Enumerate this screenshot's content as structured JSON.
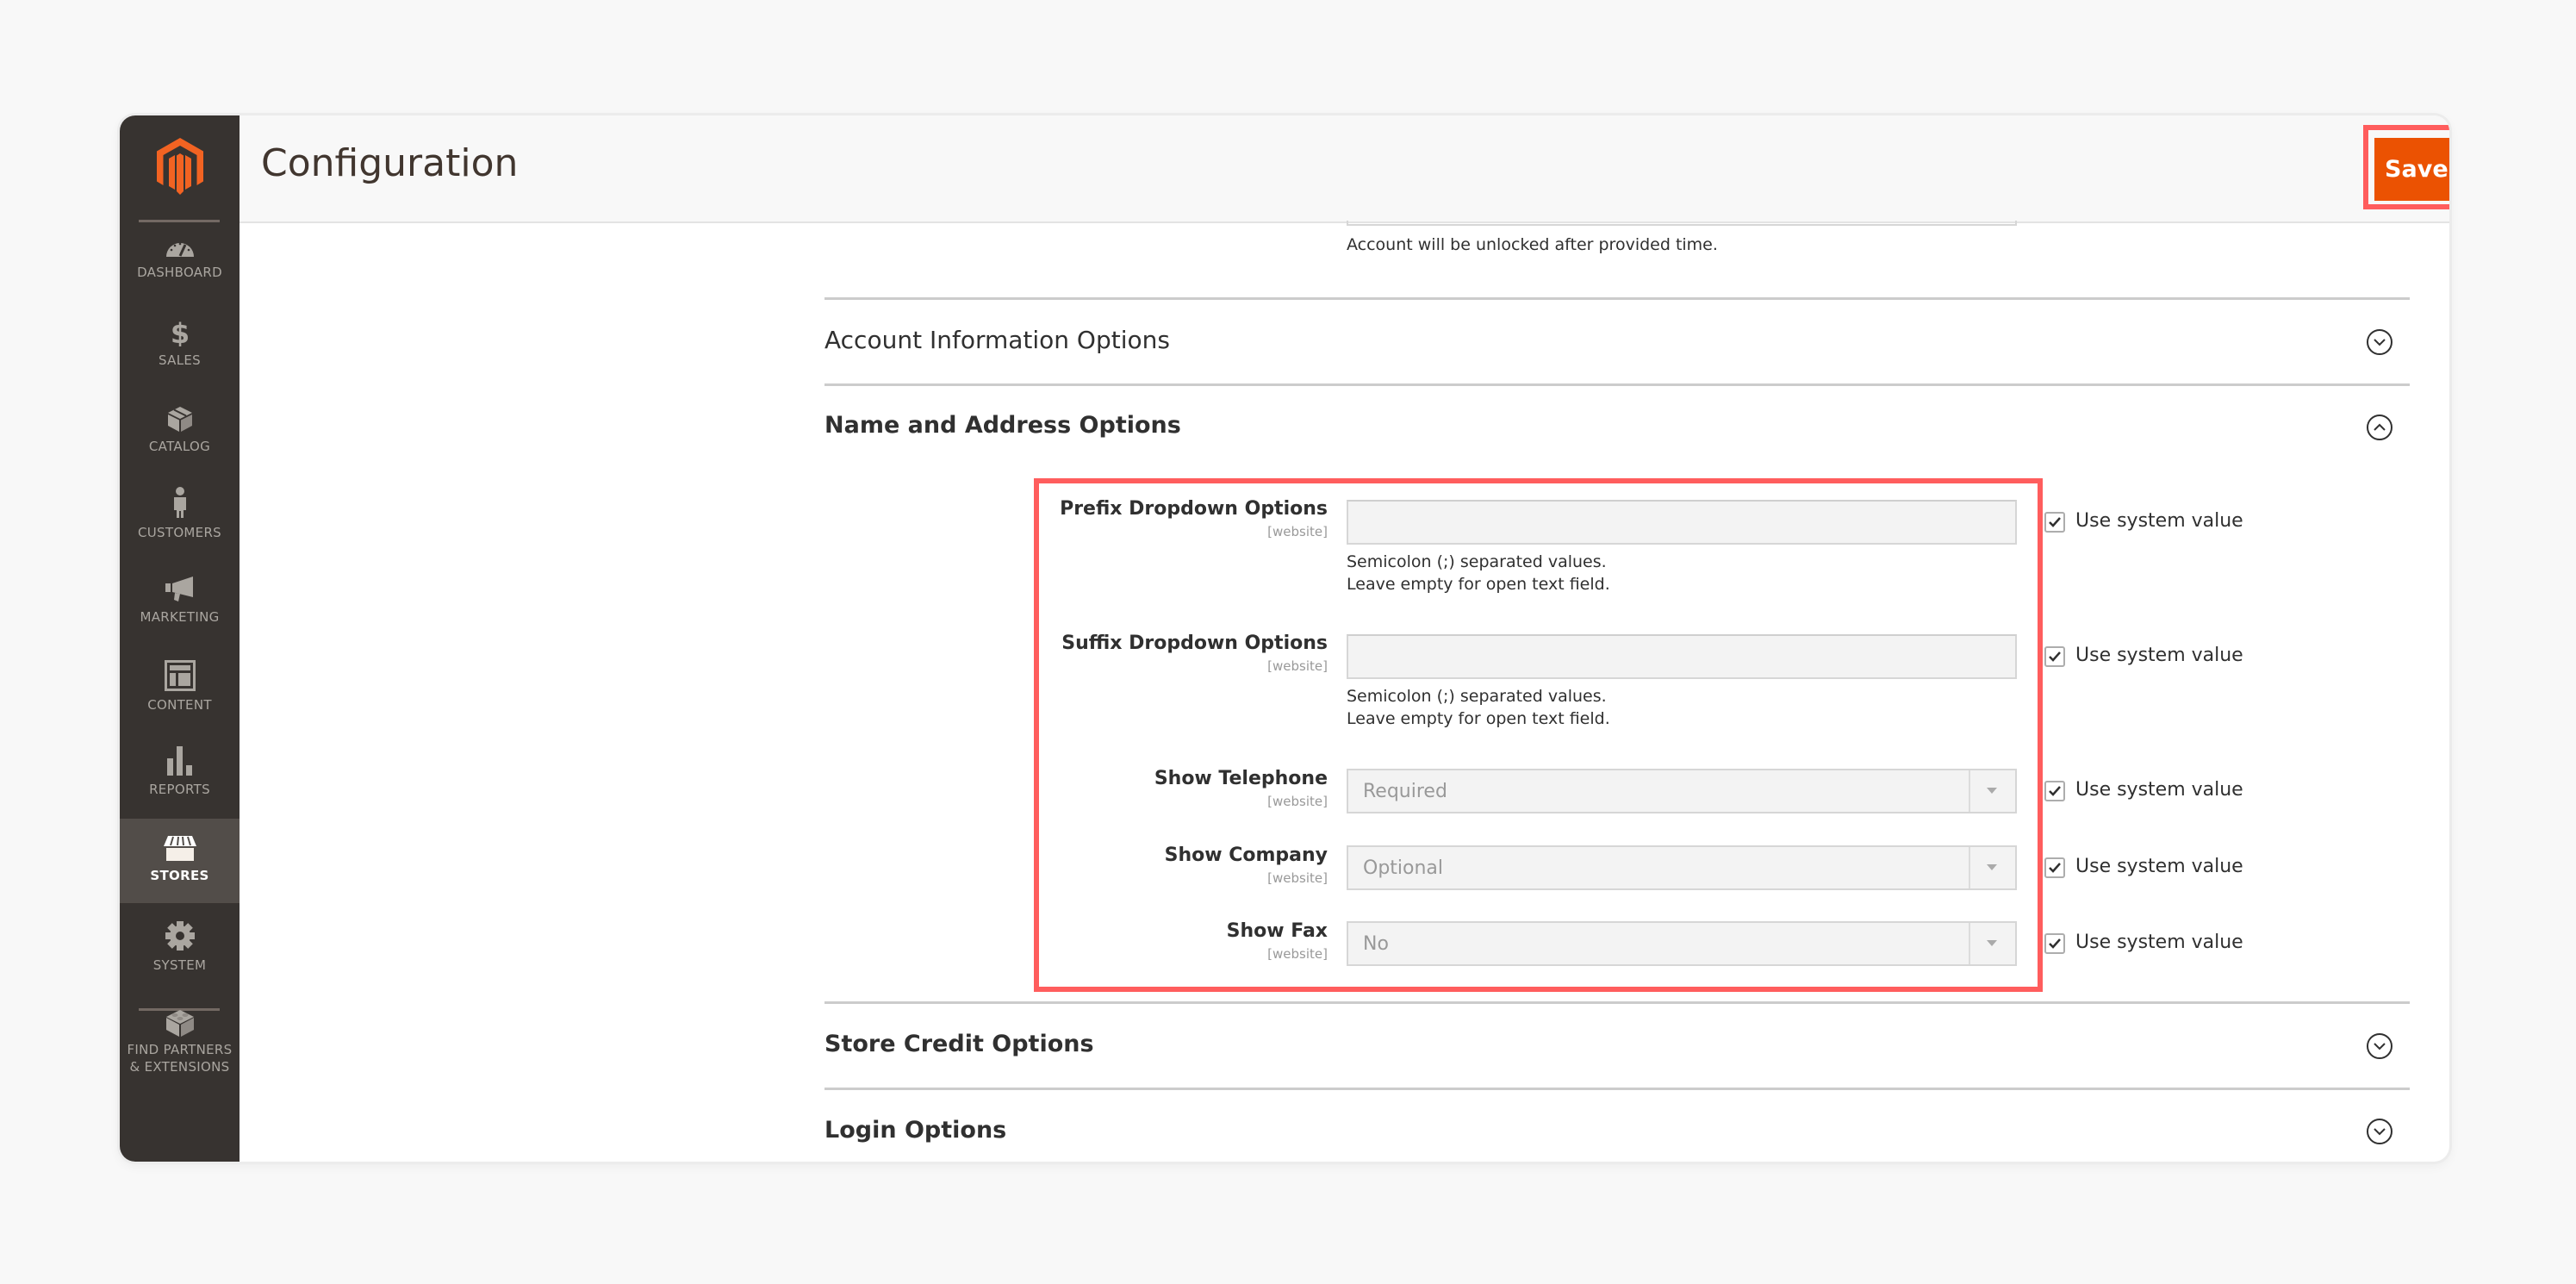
{
  "sidebar": {
    "logo": "magento-logo",
    "items": [
      {
        "label": "DASHBOARD",
        "icon": "dashboard-icon",
        "active": false
      },
      {
        "label": "SALES",
        "icon": "dollar-icon",
        "active": false
      },
      {
        "label": "CATALOG",
        "icon": "box-icon",
        "active": false
      },
      {
        "label": "CUSTOMERS",
        "icon": "person-icon",
        "active": false
      },
      {
        "label": "MARKETING",
        "icon": "megaphone-icon",
        "active": false
      },
      {
        "label": "CONTENT",
        "icon": "layout-icon",
        "active": false
      },
      {
        "label": "REPORTS",
        "icon": "bar-chart-icon",
        "active": false
      },
      {
        "label": "STORES",
        "icon": "storefront-icon",
        "active": true
      },
      {
        "label": "SYSTEM",
        "icon": "gear-icon",
        "active": false
      },
      {
        "label": "FIND PARTNERS",
        "label2": "& EXTENSIONS",
        "icon": "lego-brick-icon",
        "active": false
      }
    ]
  },
  "header": {
    "title": "Configuration",
    "save_label": "Save Config"
  },
  "main": {
    "lockout_note": "Account will be unlocked after provided time.",
    "sections": [
      {
        "title": "Account Information Options",
        "expanded": false
      },
      {
        "title": "Name and Address Options",
        "expanded": true
      },
      {
        "title": "Store Credit Options",
        "expanded": false
      },
      {
        "title": "Login Options",
        "expanded": false
      }
    ],
    "fields": {
      "prefix": {
        "label": "Prefix Dropdown Options",
        "scope": "[website]",
        "value": "",
        "note1": "Semicolon (;) separated values.",
        "note2": "Leave empty for open text field.",
        "use_system_value": true
      },
      "suffix": {
        "label": "Suffix Dropdown Options",
        "scope": "[website]",
        "value": "",
        "note1": "Semicolon (;) separated values.",
        "note2": "Leave empty for open text field.",
        "use_system_value": true
      },
      "telephone": {
        "label": "Show Telephone",
        "scope": "[website]",
        "value": "Required",
        "use_system_value": true
      },
      "company": {
        "label": "Show Company",
        "scope": "[website]",
        "value": "Optional",
        "use_system_value": true
      },
      "fax": {
        "label": "Show Fax",
        "scope": "[website]",
        "value": "No",
        "use_system_value": true
      }
    },
    "use_system_value_label": "Use system value"
  },
  "colors": {
    "accent": "#eb5202",
    "highlight": "#ff5d5d",
    "sidebar_bg": "#373330",
    "sidebar_active": "#524d49"
  }
}
